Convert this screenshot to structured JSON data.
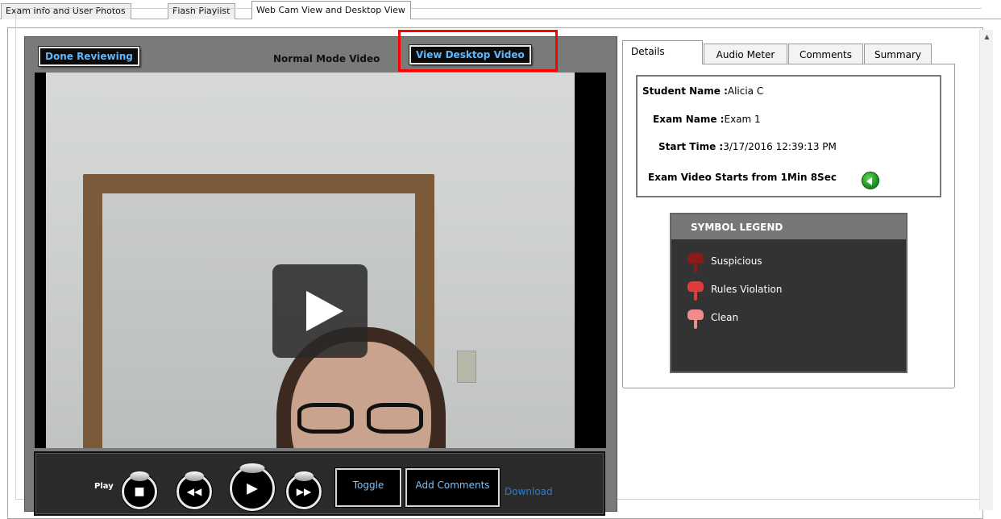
{
  "top_tabs": [
    {
      "label": "Exam Info and User Photos"
    },
    {
      "label": "Flash Playlist"
    },
    {
      "label": "Web Cam View and Desktop View"
    }
  ],
  "video": {
    "done_reviewing_label": "Done Reviewing",
    "mode_title": "Normal Mode Video",
    "view_desktop_label": "View Desktop Video"
  },
  "controls": {
    "play_label": "Play",
    "toggle_label": "Toggle",
    "add_comments_label": "Add Comments",
    "download_label": "Download"
  },
  "right_tabs": [
    {
      "label": "Details"
    },
    {
      "label": "Audio Meter"
    },
    {
      "label": "Comments"
    },
    {
      "label": "Summary"
    }
  ],
  "details": {
    "student_name_label": "Student Name :",
    "student_name_value": "Alicia C",
    "exam_name_label": "Exam Name :",
    "exam_name_value": "Exam 1",
    "start_time_label": "Start Time :",
    "start_time_value": "3/17/2016 12:39:13 PM",
    "video_start_label": "Exam Video Starts from 1Min 8Sec"
  },
  "legend": {
    "title": "SYMBOL LEGEND",
    "items": [
      {
        "label": "Suspicious",
        "color": "#8b1a1a"
      },
      {
        "label": "Rules Violation",
        "color": "#e03a3a"
      },
      {
        "label": "Clean",
        "color": "#f08b8b"
      }
    ]
  },
  "colors": {
    "highlight": "#ff0000",
    "link": "#2a7fd4",
    "button_text": "#5db8ff"
  }
}
